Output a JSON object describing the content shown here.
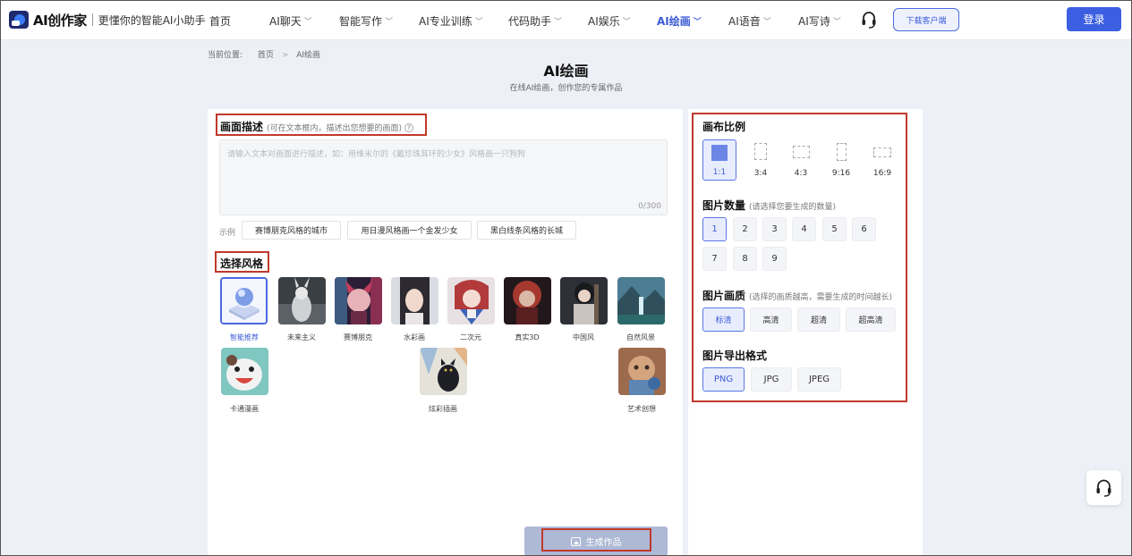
{
  "header": {
    "logo_text": "AI创作家",
    "slogan": "更懂你的智能AI小助手",
    "nav": [
      {
        "label": "首页",
        "has_dropdown": false
      },
      {
        "label": "AI聊天",
        "has_dropdown": true
      },
      {
        "label": "智能写作",
        "has_dropdown": true
      },
      {
        "label": "AI专业训练",
        "has_dropdown": true
      },
      {
        "label": "代码助手",
        "has_dropdown": true
      },
      {
        "label": "AI娱乐",
        "has_dropdown": true
      },
      {
        "label": "AI绘画",
        "has_dropdown": true,
        "active": true
      },
      {
        "label": "AI语音",
        "has_dropdown": true
      },
      {
        "label": "AI写诗",
        "has_dropdown": true
      }
    ],
    "download_label": "下载客户端",
    "login_label": "登录"
  },
  "breadcrumb": {
    "prefix": "当前位置:",
    "items": [
      "首页",
      "AI绘画"
    ],
    "separator": ">"
  },
  "page": {
    "title": "AI绘画",
    "subtitle": "在线AI绘画，创作您的专属作品"
  },
  "description": {
    "title": "画面描述",
    "hint": "(可在文本框内，描述出您想要的画面)",
    "help_icon": "?",
    "placeholder": "请输入文本对画面进行描述，如：用维米尔的《戴珍珠耳环的少女》风格画一只狗狗",
    "counter": "0/300",
    "examples_label": "示例",
    "examples": [
      "赛博朋克风格的城市",
      "用日漫风格画一个金发少女",
      "黑白线条风格的长城"
    ]
  },
  "style": {
    "title": "选择风格",
    "items": [
      {
        "label": "智能推荐",
        "selected": true,
        "icon": "smart-recommend-icon"
      },
      {
        "label": "未来主义"
      },
      {
        "label": "赛博朋克"
      },
      {
        "label": "水彩画"
      },
      {
        "label": "二次元"
      },
      {
        "label": "真实3D"
      },
      {
        "label": "中国风"
      },
      {
        "label": "自然风景"
      },
      {
        "label": "卡通漫画"
      },
      {
        "label": "炫彩插画"
      },
      {
        "label": "艺术创想"
      }
    ]
  },
  "generate_label": "生成作品",
  "canvas": {
    "ratio_title": "画布比例",
    "ratios": [
      {
        "label": "1:1",
        "selected": true
      },
      {
        "label": "3:4"
      },
      {
        "label": "4:3"
      },
      {
        "label": "9:16"
      },
      {
        "label": "16:9"
      }
    ],
    "count_title": "图片数量",
    "count_hint": "(请选择您要生成的数量)",
    "counts": [
      "1",
      "2",
      "3",
      "4",
      "5",
      "6",
      "7",
      "8",
      "9"
    ],
    "count_selected": "1",
    "quality_title": "图片画质",
    "quality_hint": "(选择的画质越高，需要生成的时间越长)",
    "qualities": [
      {
        "label": "标清",
        "selected": true
      },
      {
        "label": "高清"
      },
      {
        "label": "超清"
      },
      {
        "label": "超高清"
      }
    ],
    "format_title": "图片导出格式",
    "formats": [
      {
        "label": "PNG",
        "selected": true
      },
      {
        "label": "JPG"
      },
      {
        "label": "JPEG"
      }
    ]
  },
  "colors": {
    "accent": "#3c5bd6",
    "login_bg": "#3b5fe0",
    "annotation_red": "#c0392b",
    "generate_btn": "#aeb9d6",
    "page_bg": "#eef0f7"
  }
}
